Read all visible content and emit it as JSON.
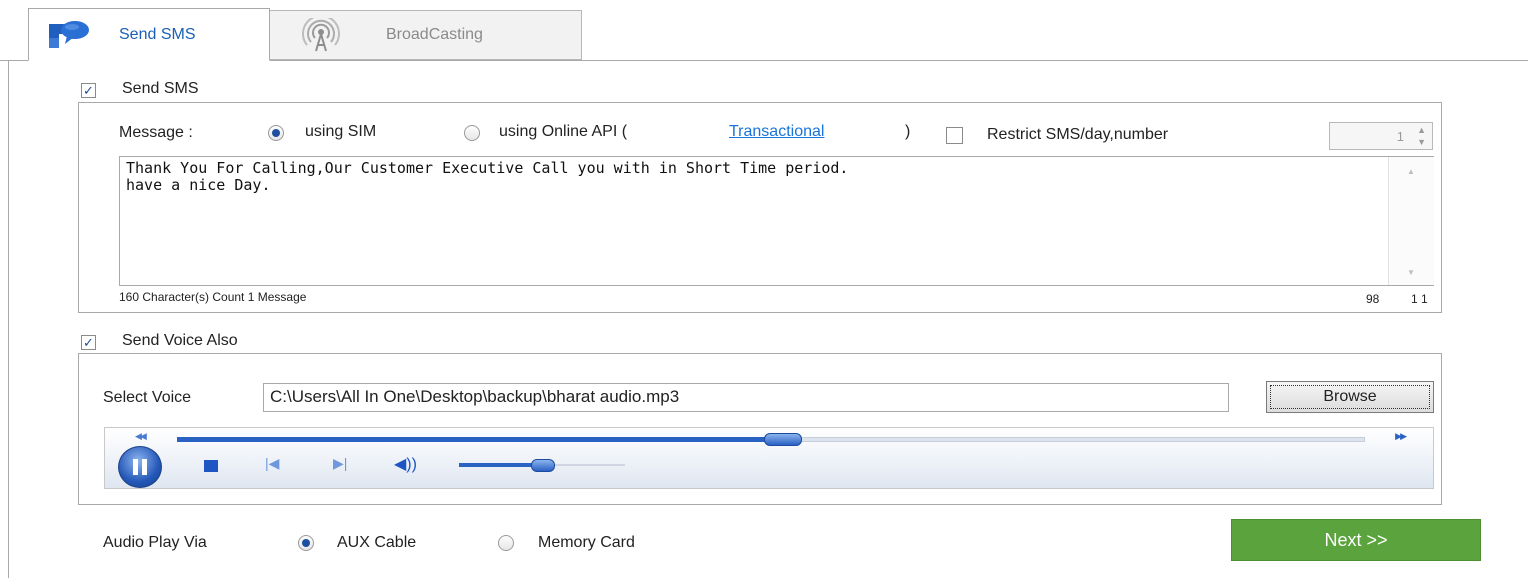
{
  "tabs": [
    {
      "label": "Send SMS",
      "icon": "chat-bubble-icon",
      "active": true
    },
    {
      "label": "BroadCasting",
      "icon": "broadcast-antenna-icon",
      "active": false
    }
  ],
  "sms": {
    "enable_label": "Send SMS",
    "enabled": true,
    "message_label": "Message :",
    "option_sim": "using SIM",
    "option_api": "using Online API (",
    "api_link": "Transactional",
    "api_close": ")",
    "selected": "using SIM",
    "restrict_label": "Restrict SMS/day,number",
    "restrict_checked": false,
    "restrict_value": "1",
    "message_text": "Thank You For Calling,Our Customer Executive Call you with in Short Time period.\nhave a nice Day.",
    "char_info": "160 Character(s) Count 1 Message",
    "count_left": "98",
    "count_right": "1 1"
  },
  "voice": {
    "enable_label": "Send Voice Also",
    "enabled": true,
    "select_label": "Select Voice",
    "path": "C:\\Users\\All In One\\Desktop\\backup\\bharat audio.mp3",
    "browse_label": "Browse",
    "playback_progress": 0.51,
    "volume": 0.5
  },
  "audio": {
    "label": "Audio Play Via",
    "option_aux": "AUX Cable",
    "option_memory": "Memory Card",
    "selected": "AUX Cable"
  },
  "actions": {
    "next_label": "Next >>"
  },
  "colors": {
    "accent": "#1a5fb4",
    "next": "#5aa33d",
    "link": "#1a74d9",
    "player_blue": "#2a62c4"
  }
}
